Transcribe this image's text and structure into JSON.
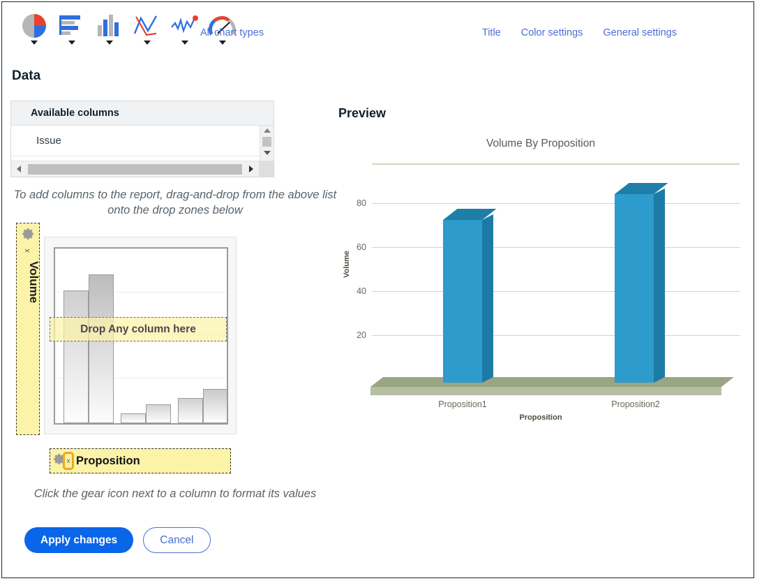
{
  "toolbar": {
    "chart_type_icons": [
      {
        "name": "pie-chart-icon",
        "label": "Pie chart"
      },
      {
        "name": "bar-chart-horizontal-icon",
        "label": "Horizontal bar chart"
      },
      {
        "name": "column-chart-icon",
        "label": "Column chart"
      },
      {
        "name": "line-chart-icon",
        "label": "Line chart"
      },
      {
        "name": "spline-chart-icon",
        "label": "Spline chart"
      },
      {
        "name": "gauge-chart-icon",
        "label": "Gauge chart"
      }
    ],
    "all_chart_types": "All chart types",
    "nav_links": [
      "Title",
      "Color settings",
      "General settings"
    ]
  },
  "data_section": {
    "heading": "Data",
    "available_columns_header": "Available columns",
    "available_columns": [
      "Issue"
    ],
    "hint_top": "To add columns to the report, drag-and-drop from the above list onto the drop zones below",
    "hint_bottom": "Click the gear icon next to a column to format its values",
    "vertical_drop_zone": {
      "label": "Volume",
      "gear_title": "Format values",
      "remove_title": "x"
    },
    "inner_drop_zone_label": "Drop Any column here",
    "horizontal_drop_zone": {
      "label": "Proposition",
      "gear_title": "Format values",
      "remove_title": "x"
    }
  },
  "buttons": {
    "apply": "Apply changes",
    "cancel": "Cancel"
  },
  "preview": {
    "heading": "Preview"
  },
  "colors": {
    "link_blue": "#4a6fd4",
    "primary_blue": "#0a66e8",
    "bar_front": "#2d9ccd",
    "bar_side": "#1b7ba6",
    "base_top": "#9aa583",
    "base_front": "#b6bfa2",
    "gridline": "#cdd9c1",
    "dropzone_yellow": "#fbf3a8",
    "focus_orange": "#f0a818"
  },
  "chart_data": {
    "type": "bar",
    "title": "Volume By Proposition",
    "xlabel": "Proposition",
    "ylabel": "Volume",
    "categories": [
      "Proposition1",
      "Proposition2"
    ],
    "values": [
      77,
      89
    ],
    "yticks": [
      20,
      40,
      60,
      80
    ],
    "ylim": [
      0,
      100
    ],
    "grid": true,
    "legend": false,
    "three_d": true
  },
  "placeholder_chart": {
    "type": "bar",
    "values": [
      56,
      72,
      5,
      11,
      15,
      21
    ]
  }
}
